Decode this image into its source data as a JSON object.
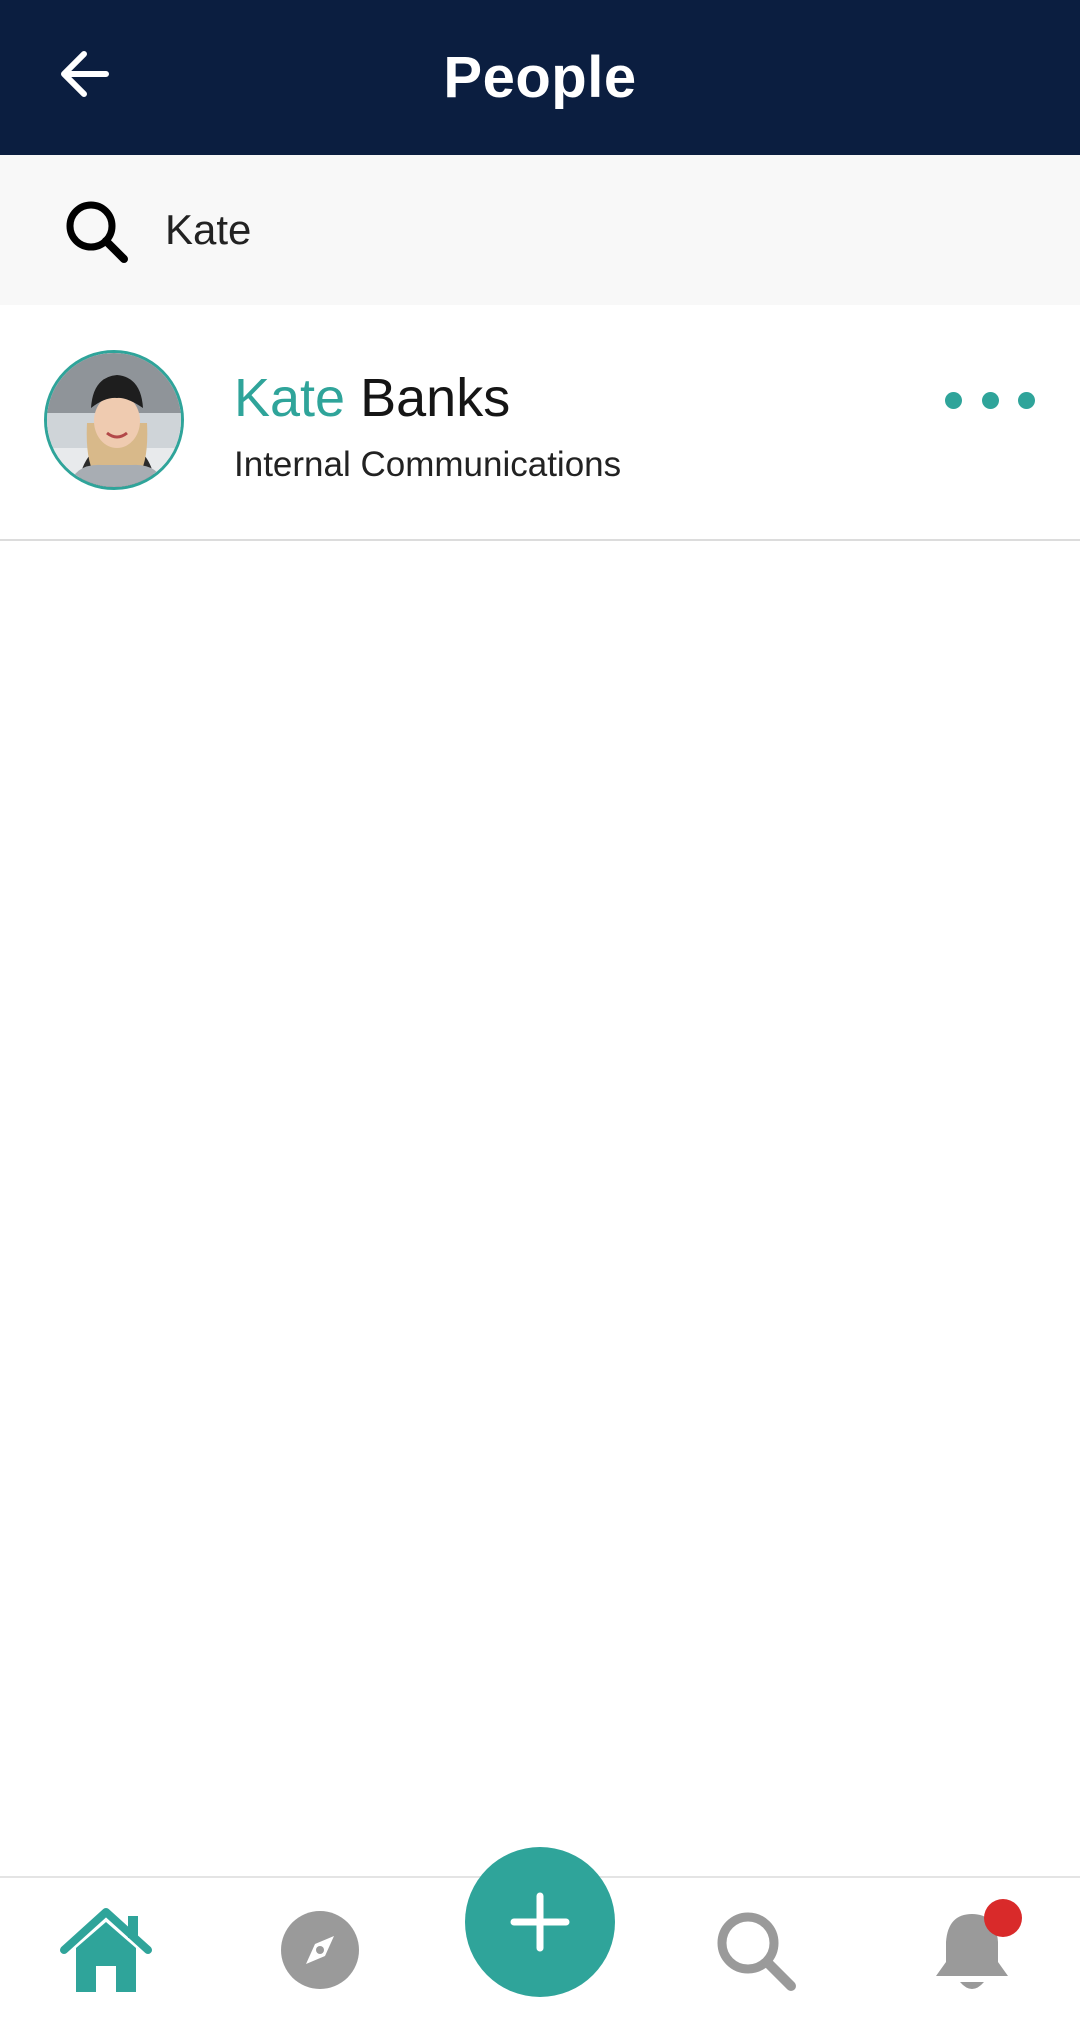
{
  "header": {
    "title": "People",
    "back_icon": "arrow-left-icon"
  },
  "search": {
    "value": "Kate",
    "placeholder": "Search",
    "icon": "search-icon"
  },
  "results": [
    {
      "first_name": "Kate",
      "last_name": "Banks",
      "department": "Internal Communications",
      "avatar": "avatar-photo",
      "more_icon": "more-dots-icon"
    }
  ],
  "bottom_nav": {
    "items": [
      {
        "name": "home",
        "icon": "home-icon",
        "active": true
      },
      {
        "name": "explore",
        "icon": "compass-icon",
        "active": false
      },
      {
        "name": "create",
        "icon": "plus-icon",
        "active": false
      },
      {
        "name": "search",
        "icon": "search-icon",
        "active": false
      },
      {
        "name": "notifications",
        "icon": "bell-icon",
        "active": false,
        "badge": true
      }
    ]
  },
  "colors": {
    "header_bg": "#0b1e40",
    "accent": "#2fa49a",
    "inactive_icon": "#9a9a9a",
    "badge": "#d92a2a"
  }
}
